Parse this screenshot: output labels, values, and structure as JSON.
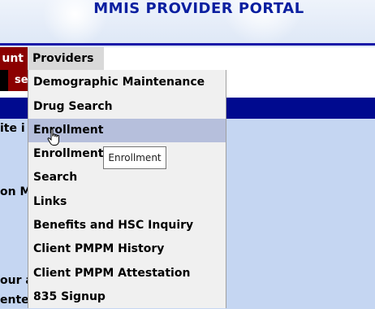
{
  "header": {
    "title": "MMIS PROVIDER PORTAL"
  },
  "menubar": {
    "account_tab": "unt",
    "providers_tab": "Providers"
  },
  "subbar": {
    "left_fragment": "se"
  },
  "background_text": {
    "line1": "ite i",
    "line2": "on M",
    "line3": "our a",
    "line4": "ente"
  },
  "dropdown": {
    "items": [
      {
        "label": "Demographic Maintenance"
      },
      {
        "label": "Drug Search"
      },
      {
        "label": "Enrollment"
      },
      {
        "label": "Enrollment Tracking"
      },
      {
        "label": "Search"
      },
      {
        "label": "Links"
      },
      {
        "label": "Benefits and HSC Inquiry"
      },
      {
        "label": "Client PMPM History"
      },
      {
        "label": "Client PMPM Attestation"
      },
      {
        "label": "835 Signup"
      }
    ],
    "highlighted_index": 2
  },
  "tooltip": {
    "text": "Enrollment"
  },
  "cursor": {
    "icon": "hand-pointer-icon"
  },
  "colors": {
    "title": "#0b1fa0",
    "account_tab": "#8b0000",
    "navy_band": "#000a8f",
    "content_bg": "#c5d6f2",
    "menu_highlight": "#b6bfdc"
  }
}
